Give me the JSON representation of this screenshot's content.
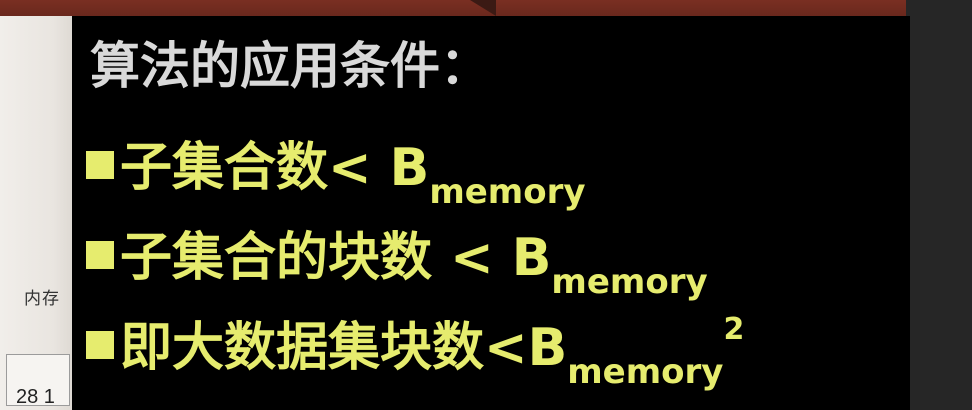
{
  "background_paper": {
    "label": "内存",
    "number": "28 1"
  },
  "slide": {
    "title": "算法的应用条件：",
    "conditions": [
      {
        "text": "子集合数< B",
        "subscript": "memory",
        "superscript": ""
      },
      {
        "text": "子集合的块数 < B",
        "subscript": "memory",
        "superscript": ""
      },
      {
        "text": "即大数据集块数<B",
        "subscript": "memory",
        "superscript": "2"
      }
    ]
  },
  "colors": {
    "slide_background": "#000000",
    "title_text": "#d9d9d9",
    "condition_text": "#e6ec6e",
    "top_strip": "#7a2f22"
  },
  "icons": {
    "bullet": "filled-square-bullet-icon"
  }
}
